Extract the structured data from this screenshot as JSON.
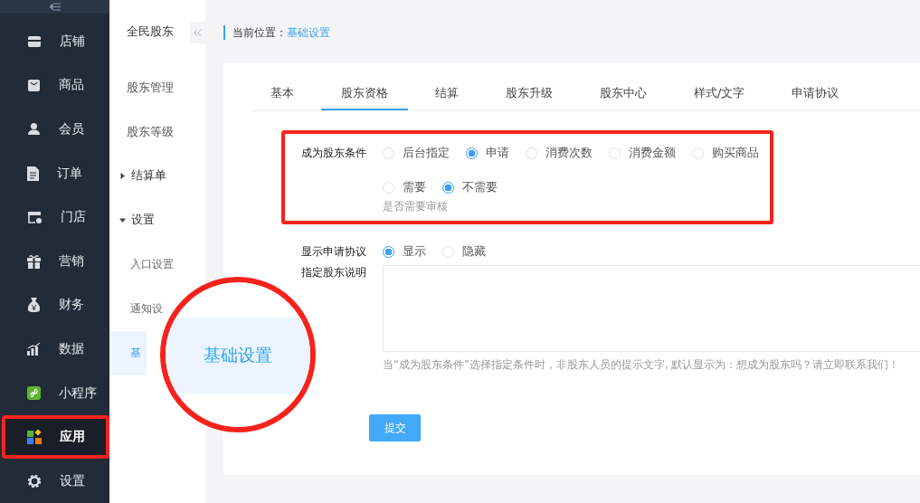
{
  "nav": {
    "items": [
      {
        "label": "店铺",
        "selected": false,
        "highlighted": false
      },
      {
        "label": "商品",
        "selected": false,
        "highlighted": false
      },
      {
        "label": "会员",
        "selected": false,
        "highlighted": false
      },
      {
        "label": "订单",
        "selected": false,
        "highlighted": false
      },
      {
        "label": "门店",
        "selected": false,
        "highlighted": false
      },
      {
        "label": "营销",
        "selected": false,
        "highlighted": false
      },
      {
        "label": "财务",
        "selected": false,
        "highlighted": false
      },
      {
        "label": "数据",
        "selected": false,
        "highlighted": false
      },
      {
        "label": "小程序",
        "selected": false,
        "highlighted": false
      },
      {
        "label": "应用",
        "selected": true,
        "highlighted": true
      },
      {
        "label": "设置",
        "selected": false,
        "highlighted": false
      }
    ]
  },
  "sub_nav": {
    "title": "全民股东",
    "items": [
      {
        "label": "股东管理",
        "kind": "link",
        "selected": false
      },
      {
        "label": "股东等级",
        "kind": "link",
        "selected": false
      },
      {
        "label": "结算单",
        "kind": "group",
        "expanded": false,
        "selected": false
      },
      {
        "label": "设置",
        "kind": "group",
        "expanded": true,
        "selected": false
      },
      {
        "label": "入口设置",
        "kind": "child",
        "selected": false
      },
      {
        "label": "通知设",
        "kind": "child",
        "selected": false
      },
      {
        "label": "基",
        "kind": "child",
        "selected": true
      }
    ]
  },
  "breadcrumb": {
    "label": "当前位置：",
    "current": "基础设置"
  },
  "tabs": [
    {
      "label": "基本",
      "selected": false
    },
    {
      "label": "股东资格",
      "selected": true
    },
    {
      "label": "结算",
      "selected": false
    },
    {
      "label": "股东升级",
      "selected": false
    },
    {
      "label": "股东中心",
      "selected": false
    },
    {
      "label": "样式/文字",
      "selected": false
    },
    {
      "label": "申请协议",
      "selected": false
    }
  ],
  "form": {
    "section": {
      "highlighted": true,
      "condition": {
        "label": "成为股东条件",
        "options": [
          {
            "label": "后台指定",
            "selected": false
          },
          {
            "label": "申请",
            "selected": true
          },
          {
            "label": "消费次数",
            "selected": false
          },
          {
            "label": "消费金额",
            "selected": false
          },
          {
            "label": "购买商品",
            "selected": false
          }
        ]
      },
      "review": {
        "options": [
          {
            "label": "需要",
            "selected": false
          },
          {
            "label": "不需要",
            "selected": true
          }
        ],
        "hint": "是否需要审核"
      }
    },
    "agreement": {
      "label": "显示申请协议",
      "options": [
        {
          "label": "显示",
          "selected": true
        },
        {
          "label": "隐藏",
          "selected": false
        }
      ]
    },
    "description": {
      "label": "指定股东说明",
      "hint": "当“成为股东条件”选择指定条件时，非股东人员的提示文字, 默认显示为：想成为股东吗？请立即联系我们！"
    },
    "submit": "提交"
  },
  "magnifier": {
    "text": "基础设置"
  }
}
